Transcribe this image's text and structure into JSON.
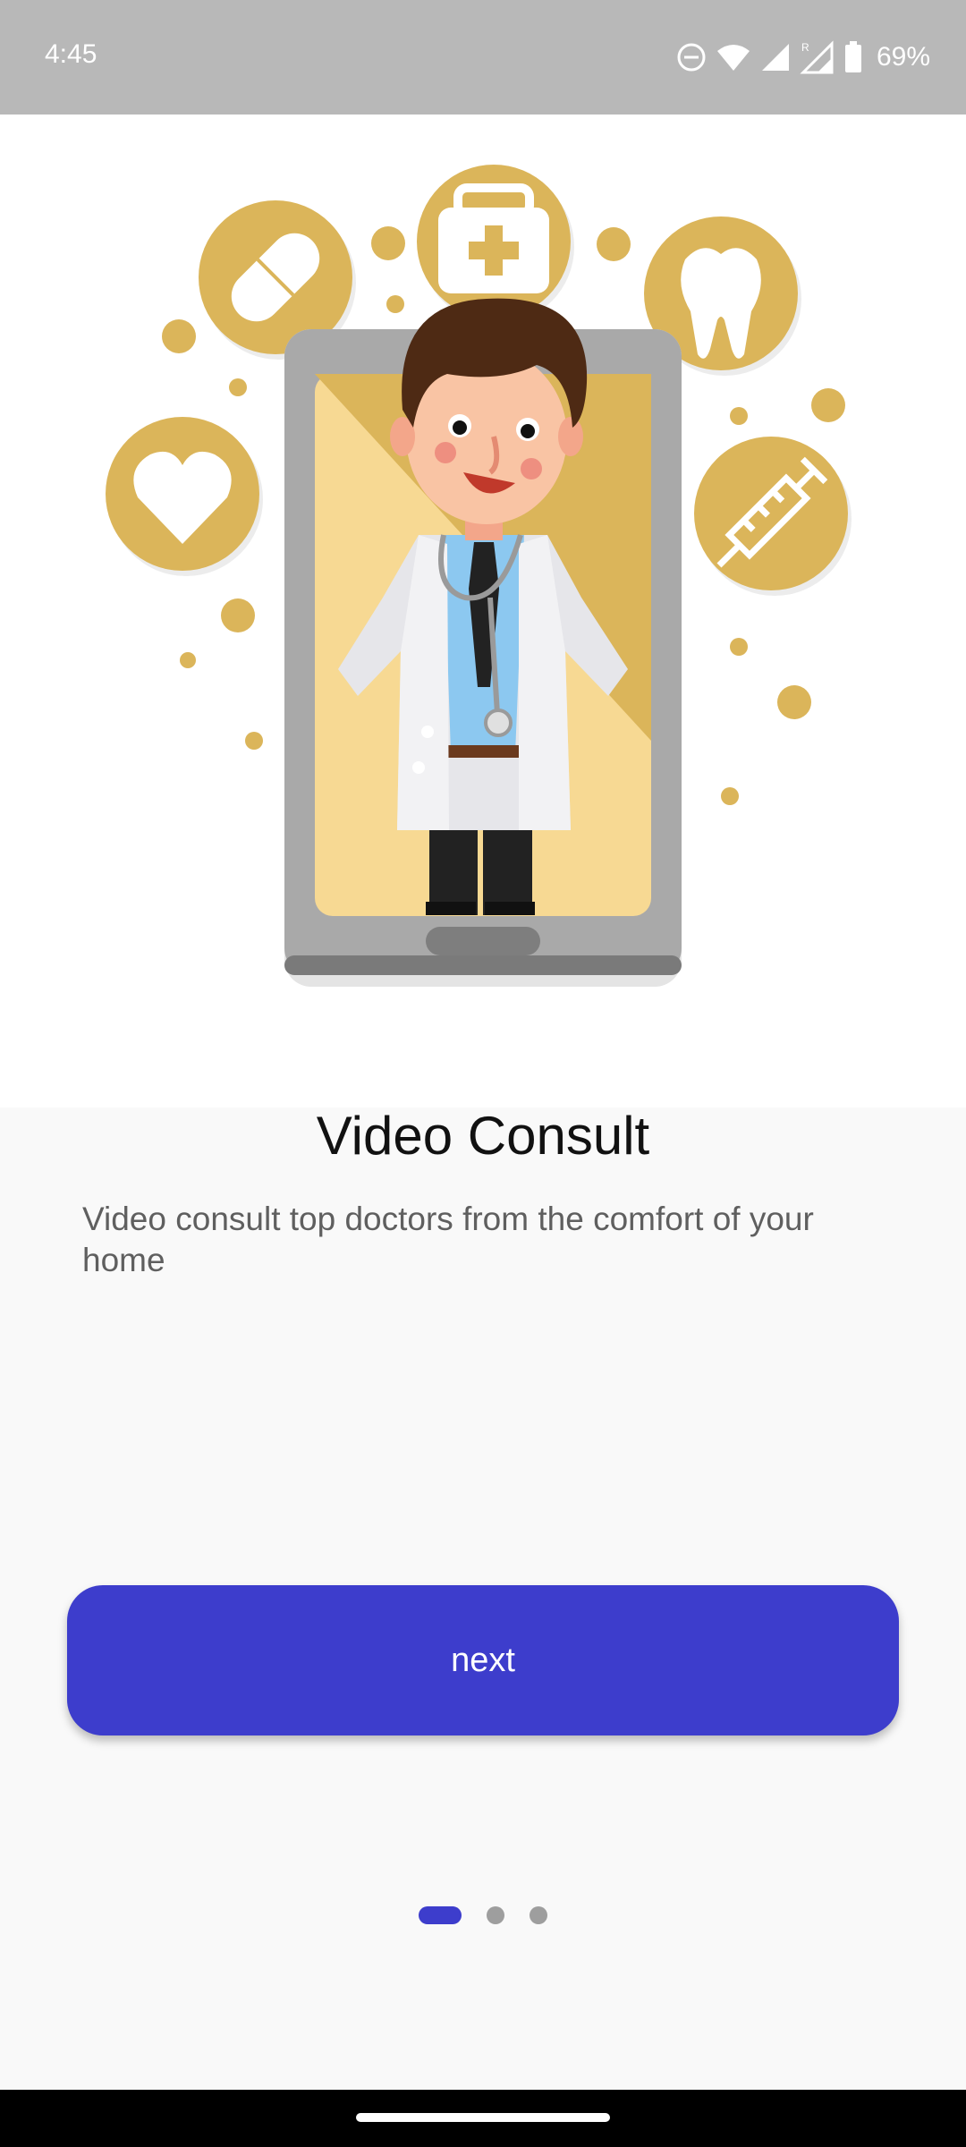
{
  "status_bar": {
    "time": "4:45",
    "battery": "69%",
    "icons": [
      "do-not-disturb-icon",
      "wifi-icon",
      "signal-icon",
      "signal-roaming-icon",
      "battery-icon"
    ]
  },
  "hero": {
    "illustration": "doctor-in-phone-illustration",
    "accent_color": "#dbb55a"
  },
  "onboarding": {
    "title": "Video Consult",
    "description": "Video consult top doctors from the comfort of your home",
    "next_label": "next"
  },
  "pager": {
    "count": 3,
    "active_index": 0
  },
  "colors": {
    "primary": "#3d3dcc",
    "status_bar": "#b8b8b8"
  }
}
